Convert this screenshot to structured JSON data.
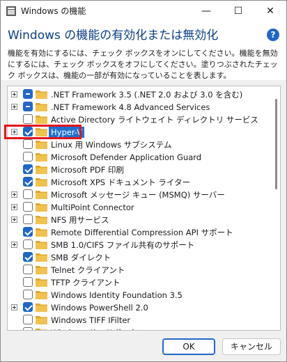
{
  "window": {
    "title": "Windows の機能",
    "minimize_glyph": "—",
    "maximize_glyph": "☐",
    "close_glyph": "✕"
  },
  "header": {
    "heading": "Windows の機能の有効化または無効化",
    "help_label": "?",
    "description": "機能を有効にするには、チェック ボックスをオンにしてください。機能を無効にするには、チェック ボックスをオフにしてください。塗りつぶされたチェック ボックスは、機能の一部が有効になっていることを表します。"
  },
  "features": [
    {
      "label": ".NET Framework 3.5 (.NET 2.0 および 3.0 を含む)",
      "state": "partial",
      "expandable": true
    },
    {
      "label": ".NET Framework 4.8 Advanced Services",
      "state": "partial",
      "expandable": true
    },
    {
      "label": "Active Directory ライトウェイト ディレクトリ サービス",
      "state": "unchecked",
      "expandable": false
    },
    {
      "label": "Hyper-V",
      "state": "checked",
      "expandable": true,
      "selected": true
    },
    {
      "label": "Linux 用 Windows サブシステム",
      "state": "unchecked",
      "expandable": false
    },
    {
      "label": "Microsoft Defender Application Guard",
      "state": "unchecked",
      "expandable": false
    },
    {
      "label": "Microsoft PDF 印刷",
      "state": "checked",
      "expandable": false
    },
    {
      "label": "Microsoft XPS ドキュメント ライター",
      "state": "checked",
      "expandable": false
    },
    {
      "label": "Microsoft メッセージ キュー (MSMQ) サーバー",
      "state": "unchecked",
      "expandable": true
    },
    {
      "label": "MultiPoint Connector",
      "state": "unchecked",
      "expandable": true
    },
    {
      "label": "NFS 用サービス",
      "state": "unchecked",
      "expandable": true
    },
    {
      "label": "Remote Differential Compression API サポート",
      "state": "checked",
      "expandable": false
    },
    {
      "label": "SMB 1.0/CIFS ファイル共有のサポート",
      "state": "unchecked",
      "expandable": true
    },
    {
      "label": "SMB ダイレクト",
      "state": "checked",
      "expandable": false
    },
    {
      "label": "Telnet クライアント",
      "state": "unchecked",
      "expandable": false
    },
    {
      "label": "TFTP クライアント",
      "state": "unchecked",
      "expandable": false
    },
    {
      "label": "Windows Identity Foundation 3.5",
      "state": "unchecked",
      "expandable": false
    },
    {
      "label": "Windows PowerShell 2.0",
      "state": "checked",
      "expandable": true
    },
    {
      "label": "Windows TIFF IFilter",
      "state": "unchecked",
      "expandable": false
    },
    {
      "label": "Windows サンドボックス",
      "state": "unchecked",
      "expandable": false
    }
  ],
  "buttons": {
    "ok": "OK",
    "cancel": "キャンセル"
  },
  "colors": {
    "accent": "#1f67c9",
    "heading": "#0c3f86",
    "highlight_border": "#e5141b",
    "folder": "#f2c24f"
  }
}
